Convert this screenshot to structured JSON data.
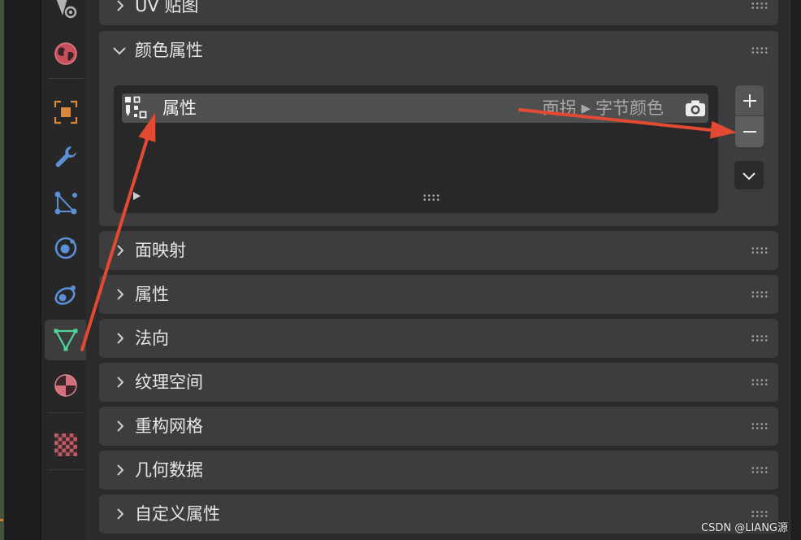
{
  "sidebar": {
    "tabs": [
      {
        "icon": "scene-icon",
        "active": false
      },
      {
        "icon": "world-icon",
        "active": false
      },
      {
        "icon": "object-icon",
        "active": false
      },
      {
        "icon": "wrench-icon",
        "active": false
      },
      {
        "icon": "particles-icon",
        "active": false
      },
      {
        "icon": "physics-icon",
        "active": false
      },
      {
        "icon": "constraints-icon",
        "active": false
      },
      {
        "icon": "mesh-data-icon",
        "active": true
      },
      {
        "icon": "material-icon",
        "active": false
      },
      {
        "icon": "texture-icon",
        "active": false
      }
    ]
  },
  "panels": [
    {
      "label": "UV 贴图",
      "expanded": false
    },
    {
      "label": "颜色属性",
      "expanded": true
    },
    {
      "label": "面映射",
      "expanded": false
    },
    {
      "label": "属性",
      "expanded": false
    },
    {
      "label": "法向",
      "expanded": false
    },
    {
      "label": "纹理空间",
      "expanded": false
    },
    {
      "label": "重构网格",
      "expanded": false
    },
    {
      "label": "几何数据",
      "expanded": false
    },
    {
      "label": "自定义属性",
      "expanded": false
    }
  ],
  "color_attributes_list": {
    "items": [
      {
        "name": "属性",
        "domain": "面拐",
        "separator": "▶",
        "data_type": "字节颜色",
        "selected": true,
        "active_render": true
      }
    ]
  },
  "watermark": "CSDN @LIANG源",
  "theme": {
    "area_bg": "#2b2b2b",
    "panel_bg": "#3d3d3d",
    "list_bg": "#282828",
    "row_selected": "#4f4f4f",
    "text": "#e6e6e6",
    "text_dim": "#a8a8a8",
    "annotation": "#e24a33",
    "icon_gray": "#b2b2b2",
    "icon_red": "#c8505b",
    "icon_orange": "#d9893b",
    "icon_blue": "#5b8fd6",
    "icon_green": "#4fd59a",
    "icon_pink": "#d4707e",
    "icon_checker": "#c25a64"
  }
}
